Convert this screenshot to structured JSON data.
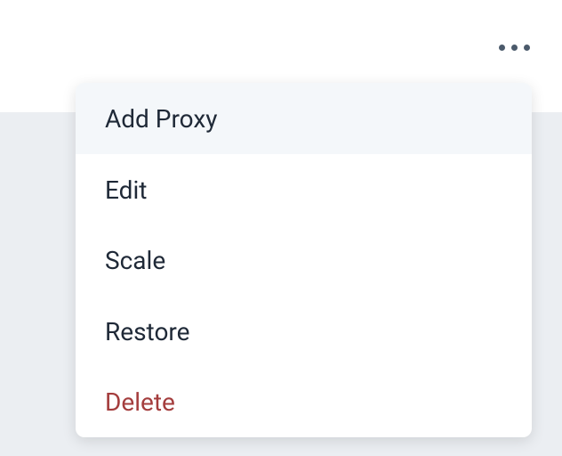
{
  "menu": {
    "items": [
      {
        "label": "Add Proxy",
        "highlighted": true
      },
      {
        "label": "Edit"
      },
      {
        "label": "Scale"
      },
      {
        "label": "Restore"
      },
      {
        "label": "Delete",
        "danger": true
      }
    ]
  }
}
